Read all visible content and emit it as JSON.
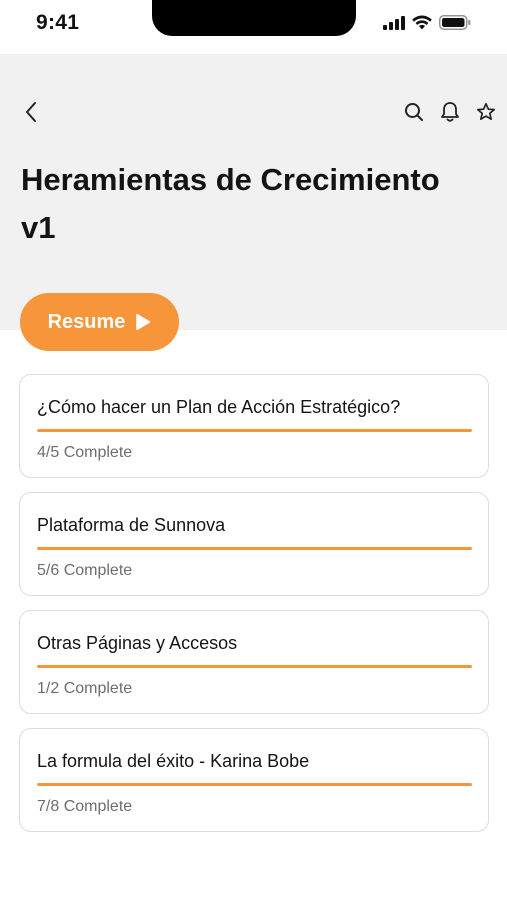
{
  "status_bar": {
    "time": "9:41"
  },
  "header": {
    "title": "Heramientas de Crecimiento v1",
    "icons": [
      "back-chevron-icon",
      "search-icon",
      "bell-icon",
      "star-icon"
    ]
  },
  "resume": {
    "label": "Resume",
    "icon": "play-icon"
  },
  "colors": {
    "accent": "#f7953a",
    "header_bg": "#f1f1f1",
    "card_border": "#dcdcdc"
  },
  "courses": [
    {
      "title": "¿Cómo hacer un Plan de Acción Estratégico?",
      "status": "4/5 Complete",
      "progress": 1.0
    },
    {
      "title": "Plataforma de Sunnova",
      "status": "5/6 Complete",
      "progress": 1.0
    },
    {
      "title": "Otras Páginas y Accesos",
      "status": "1/2 Complete",
      "progress": 1.0
    },
    {
      "title": "La formula del éxito - Karina Bobe",
      "status": "7/8 Complete",
      "progress": 1.0
    }
  ]
}
